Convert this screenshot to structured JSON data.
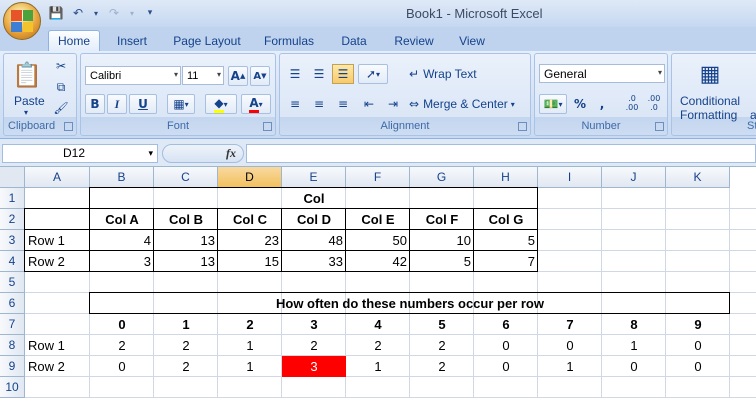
{
  "window": {
    "title": "Book1 - Microsoft Excel"
  },
  "qat": {
    "save_icon": "save-icon",
    "undo_icon": "undo-icon",
    "redo_icon": "redo-icon",
    "customize_icon": "customize-qat-icon"
  },
  "tabs": [
    "Home",
    "Insert",
    "Page Layout",
    "Formulas",
    "Data",
    "Review",
    "View"
  ],
  "ribbon": {
    "clipboard": {
      "label": "Clipboard",
      "paste": "Paste"
    },
    "font": {
      "label": "Font",
      "name": "Calibri",
      "size": "11",
      "bold": "B",
      "italic": "I",
      "underline": "U",
      "grow": "A",
      "shrink": "A",
      "fontcolor": "A"
    },
    "alignment": {
      "label": "Alignment",
      "wrap": "Wrap Text",
      "merge": "Merge & Center"
    },
    "number": {
      "label": "Number",
      "format": "General",
      "percent": "%",
      "comma": ",",
      "inc_decimal": ".0\n.00",
      "dec_decimal": ".00\n.0"
    },
    "styles": {
      "cond_line1": "Conditional",
      "cond_line2": "Formatting",
      "partial1": "a",
      "partial2": "St"
    }
  },
  "formula_bar": {
    "name_box": "D12",
    "fx": "fx",
    "content": ""
  },
  "columns": [
    "A",
    "B",
    "C",
    "D",
    "E",
    "F",
    "G",
    "H",
    "I",
    "J",
    "K"
  ],
  "rows": [
    "1",
    "2",
    "3",
    "4",
    "5",
    "6",
    "7",
    "8",
    "9",
    "10"
  ],
  "sheet": {
    "r1": {
      "title": "Col"
    },
    "r2": {
      "headers": [
        "Col A",
        "Col B",
        "Col C",
        "Col D",
        "Col E",
        "Col F",
        "Col G"
      ]
    },
    "r3": {
      "label": "Row 1",
      "values": [
        "4",
        "13",
        "23",
        "48",
        "50",
        "10",
        "5"
      ]
    },
    "r4": {
      "label": "Row 2",
      "values": [
        "3",
        "13",
        "15",
        "33",
        "42",
        "5",
        "7"
      ]
    },
    "r6": {
      "title": "How often do these numbers occur per row"
    },
    "r7": {
      "headers": [
        "0",
        "1",
        "2",
        "3",
        "4",
        "5",
        "6",
        "7",
        "8",
        "9"
      ]
    },
    "r8": {
      "label": "Row 1",
      "values": [
        "2",
        "2",
        "1",
        "2",
        "2",
        "2",
        "0",
        "0",
        "1",
        "0"
      ]
    },
    "r9": {
      "label": "Row 2",
      "values": [
        "0",
        "2",
        "1",
        "3",
        "1",
        "2",
        "0",
        "1",
        "0",
        "0"
      ]
    }
  },
  "colors": {
    "highlight_cell": "#ff0000",
    "selected_header": "#f1c15f"
  }
}
